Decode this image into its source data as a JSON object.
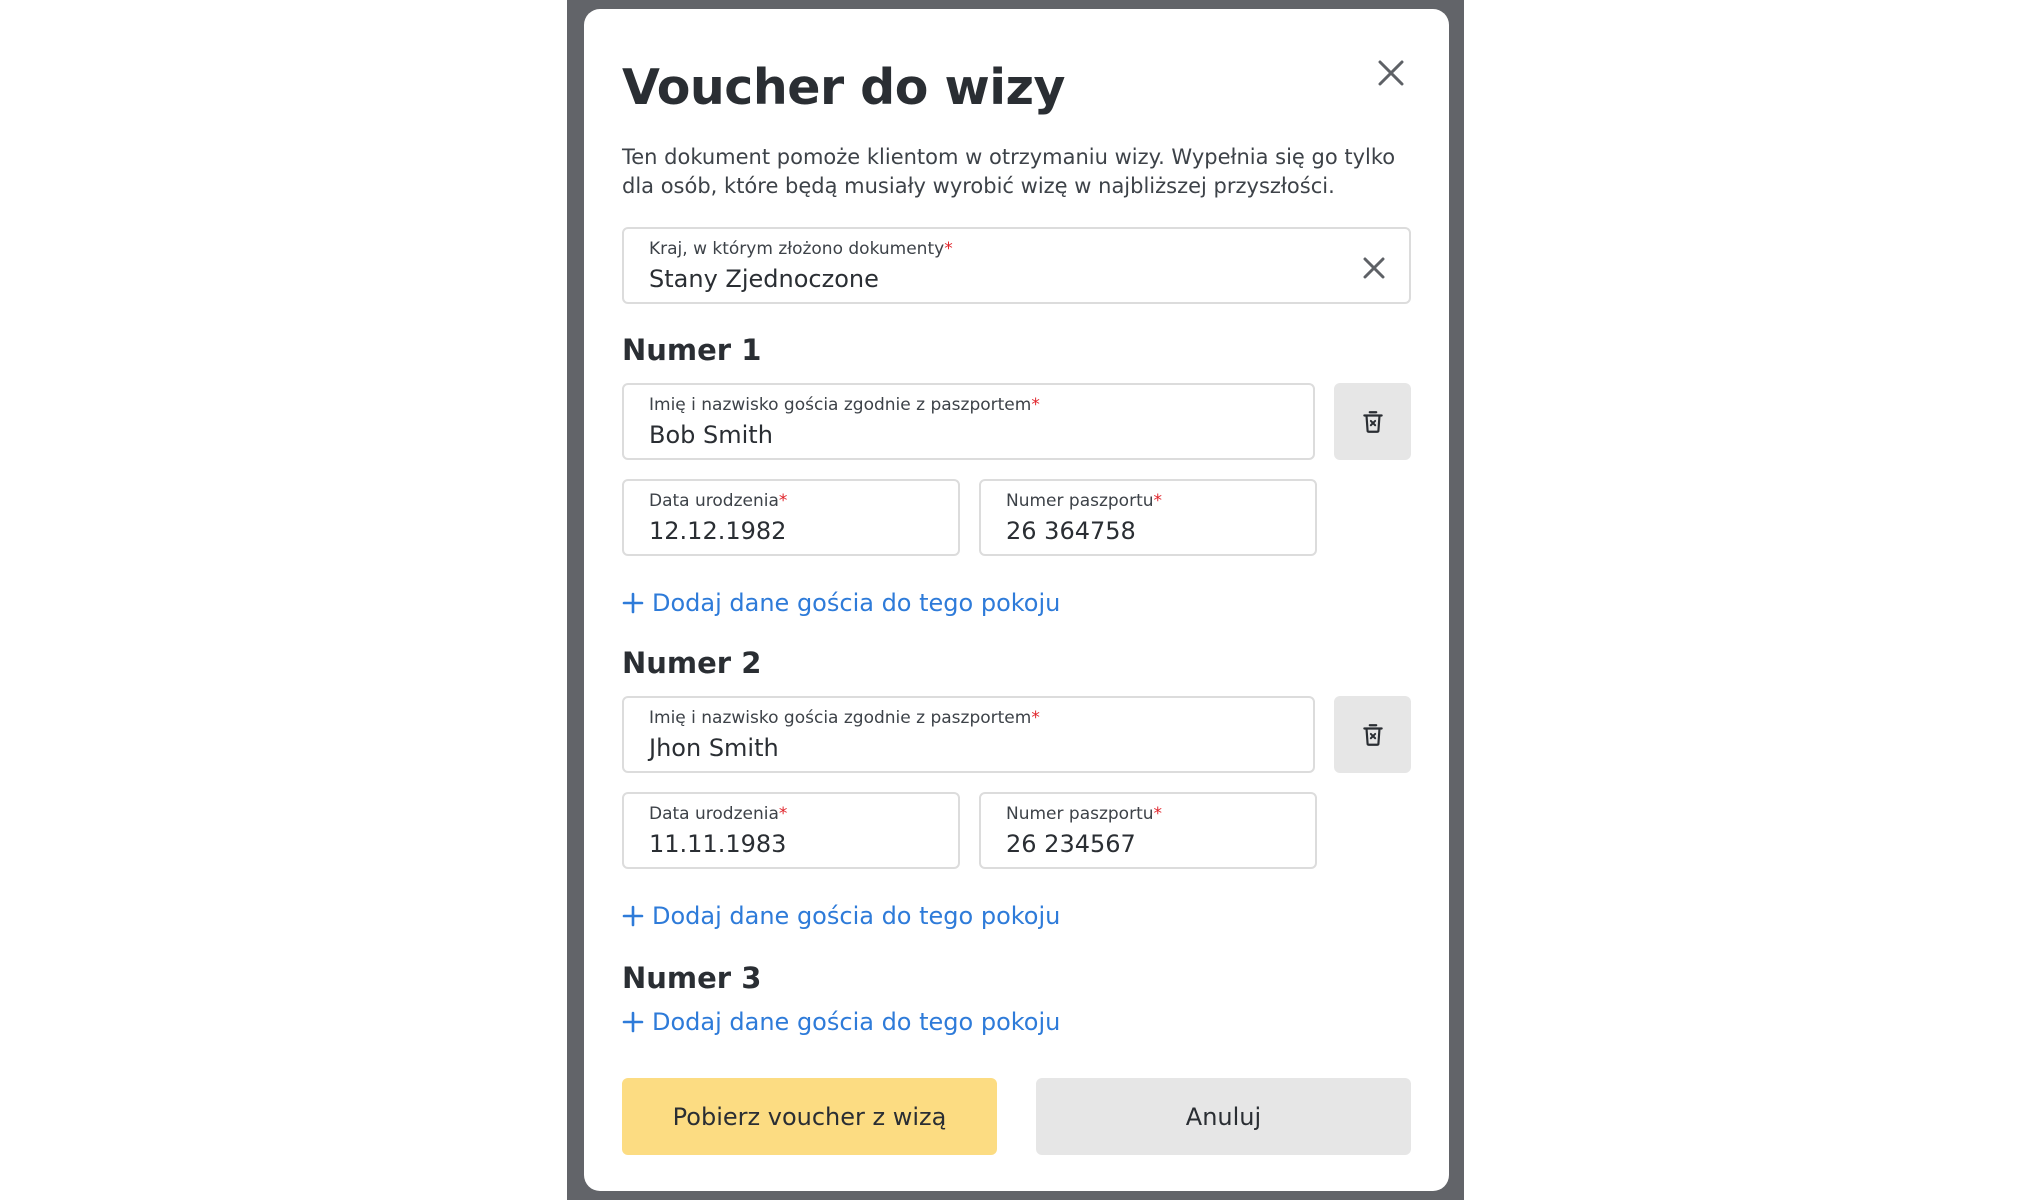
{
  "modal": {
    "title": "Voucher do wizy",
    "description": "Ten dokument pomoże klientom w otrzymaniu wizy. Wypełnia się go tylko dla osób, które będą musiały wyrobić wizę w najbliższej przyszłości.",
    "country": {
      "label": "Kraj, w którym złożono dokumenty",
      "required_mark": "*",
      "value": "Stany Zjednoczone"
    },
    "rooms": [
      {
        "title": "Numer 1",
        "name_label": "Imię i nazwisko gościa zgodnie z paszportem",
        "name_value": "Bob Smith",
        "dob_label": "Data urodzenia",
        "dob_value": "12.12.1982",
        "passport_label": "Numer paszportu",
        "passport_value": "26 364758",
        "add_label": "Dodaj dane gościa do tego pokoju"
      },
      {
        "title": "Numer 2",
        "name_label": "Imię i nazwisko gościa zgodnie z paszportem",
        "name_value": "Jhon Smith",
        "dob_label": "Data urodzenia",
        "dob_value": "11.11.1983",
        "passport_label": "Numer paszportu",
        "passport_value": "26 234567",
        "add_label": "Dodaj dane gościa do tego pokoju"
      },
      {
        "title": "Numer 3",
        "add_label": "Dodaj dane gościa do tego pokoju"
      }
    ],
    "buttons": {
      "download": "Pobierz voucher z wizą",
      "cancel": "Anuluj"
    }
  },
  "colors": {
    "backdrop": "#626469",
    "link": "#2e7bd9",
    "primary_button": "#fcdc82",
    "secondary_button": "#e6e6e6",
    "required": "#e0242b"
  },
  "icons": [
    "close-icon",
    "clear-icon",
    "trash-icon",
    "plus-icon"
  ]
}
